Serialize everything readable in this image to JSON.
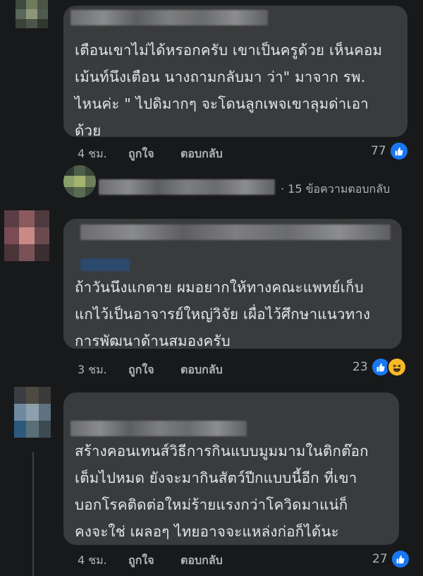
{
  "comments": [
    {
      "text": "เตือนเขาไม่ได้หรอกครับ เขาเป็นครูด้วย เห็นคอม\nเม้นท์นึงเตือน นางถามกลับมา ว่า\" มาจาก รพ.\nไหนค่ะ \" ไปดิมากๆ จะโดนลูกเพจเขาลุมด่าเอา\nด้วย",
      "time": "4 ชม.",
      "like_label": "ถูกใจ",
      "reply_label": "ตอบกลับ",
      "reaction_count": "77",
      "reactions": [
        "like-icon"
      ]
    },
    {
      "text": "ถ้าวันนึงแกตาย ผมอยากให้ทางคณะแพทย์เก็บ\nแกไว้เป็นอาจารย์ใหญ่วิจัย เผื่อไว้ศึกษาแนวทาง\nการพัฒนาด้านสมองครับ",
      "time": "3 ชม.",
      "like_label": "ถูกใจ",
      "reply_label": "ตอบกลับ",
      "reaction_count": "23",
      "reactions": [
        "like-icon",
        "haha-icon"
      ]
    },
    {
      "text": "สร้างคอนเทนส์วิธีการกินแบบมูมมามในติกต๊อก\nเต็มไปหมด ยังจะมากินสัตว์ปีกแบบนี้อีก ที่เขา\nบอกโรคติดต่อใหม่ร้ายแรงกว่าโควิดมาแน่ก็\nคงจะใช่ เผลอๆ ไทยอาจจะแหล่งก่อก็ได้นะ",
      "time": "4 ชม.",
      "like_label": "ถูกใจ",
      "reply_label": "ตอบกลับ",
      "reaction_count": "27",
      "reactions": [
        "like-icon"
      ]
    }
  ],
  "reply_summary": {
    "text": "· 15 ข้อความตอบกลับ"
  },
  "colors": {
    "background": "#18191a",
    "bubble": "#3a3b3c",
    "text": "#e4e6eb",
    "secondary_text": "#b0b3b8",
    "like_blue": "#1877f2",
    "haha_yellow": "#f7b928"
  }
}
